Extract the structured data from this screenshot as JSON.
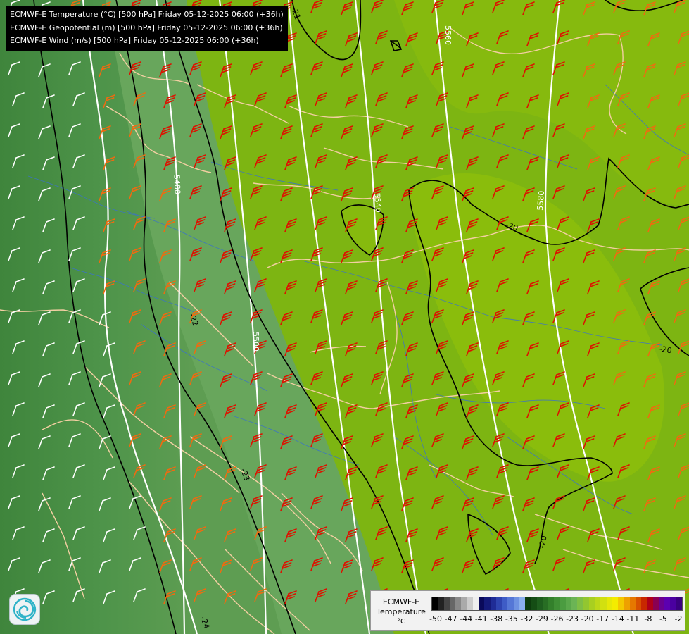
{
  "title_lines": [
    "ECMWF-E Temperature (°C) [500 hPa] Friday 05-12-2025 06:00 (+36h)",
    "ECMWF-E Geopotential (m) [500 hPa] Friday 05-12-2025 06:00 (+36h)",
    "ECMWF-E Wind (m/s) [500 hPa] Friday 05-12-2025 06:00 (+36h)"
  ],
  "geopotential_isoline_labels": [
    "5480",
    "5500",
    "5540",
    "5560",
    "5580"
  ],
  "temperature_isoline_labels": [
    "-21",
    "-22",
    "-23",
    "-24",
    "-20",
    "-20",
    "-20"
  ],
  "legend": {
    "title": "ECMWF-E",
    "subtitle": "Temperature",
    "units": "°C",
    "tick_labels": [
      "-50",
      "-47",
      "-44",
      "-41",
      "-38",
      "-35",
      "-32",
      "-29",
      "-26",
      "-23",
      "-20",
      "-17",
      "-14",
      "-11",
      "-8",
      "-5",
      "-2"
    ],
    "colors": [
      "#000000",
      "#222222",
      "#444444",
      "#666666",
      "#888888",
      "#aaaaaa",
      "#cccccc",
      "#eeeeee",
      "#0a0a5a",
      "#141a7a",
      "#1f2c96",
      "#2e44b0",
      "#3e5cc6",
      "#5577d6",
      "#6e92e2",
      "#8aaeee",
      "#0d3b0d",
      "#154d15",
      "#1e5e1e",
      "#286e24",
      "#33802b",
      "#3f8f35",
      "#4b9c40",
      "#5aa84b",
      "#6bb455",
      "#7ebe45",
      "#92c630",
      "#a8cf20",
      "#bcd818",
      "#d2e010",
      "#e6e808",
      "#f4ec00",
      "#f4c800",
      "#eea000",
      "#e67800",
      "#d85000",
      "#c82800",
      "#b00018",
      "#8a0052",
      "#6a0090",
      "#5c00b0",
      "#4a00a0",
      "#3a0080"
    ]
  },
  "colors": {
    "background_green_dark": "#4a8c40",
    "background_green_mid": "#62a458",
    "background_green_light": "#7fb30e",
    "background_green_east": "#8cbb08",
    "geopotential_line": "#ffffff",
    "temperature_line": "#000000",
    "coastline": "#f5d2a8",
    "river": "#3a6ec8",
    "wind_barb_strong": "#dd1100",
    "wind_barb_medium": "#f06a10",
    "wind_barb_light": "#ffffff"
  }
}
